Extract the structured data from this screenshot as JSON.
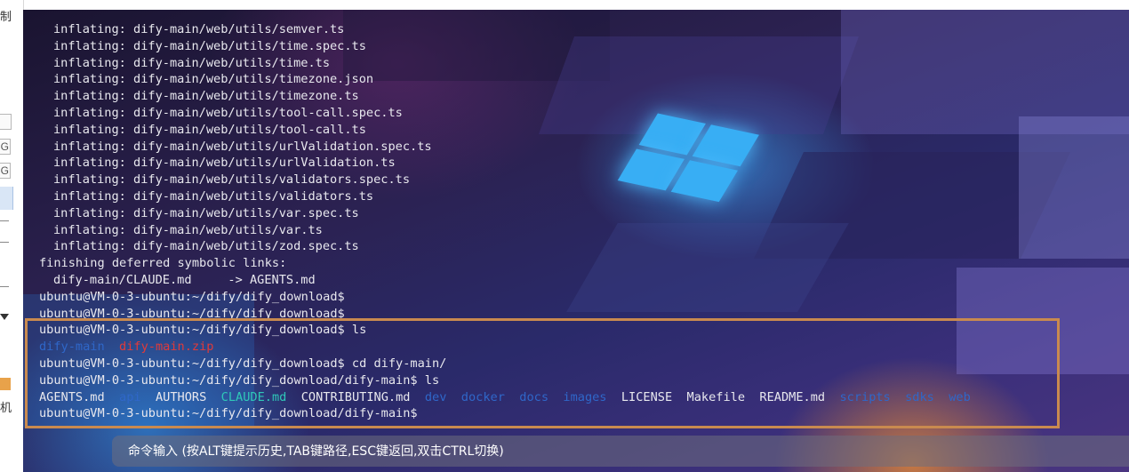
{
  "sidebar": {
    "top_char": "制",
    "box_letters": [
      "G",
      "G"
    ],
    "bottom_char": "机"
  },
  "terminal": {
    "lines": [
      {
        "indent": 1,
        "segments": [
          {
            "text": "inflating: dify-main/web/utils/semver.ts",
            "kind": "normal"
          }
        ]
      },
      {
        "indent": 1,
        "segments": [
          {
            "text": "inflating: dify-main/web/utils/time.spec.ts",
            "kind": "normal"
          }
        ]
      },
      {
        "indent": 1,
        "segments": [
          {
            "text": "inflating: dify-main/web/utils/time.ts",
            "kind": "normal"
          }
        ]
      },
      {
        "indent": 1,
        "segments": [
          {
            "text": "inflating: dify-main/web/utils/timezone.json",
            "kind": "normal"
          }
        ]
      },
      {
        "indent": 1,
        "segments": [
          {
            "text": "inflating: dify-main/web/utils/timezone.ts",
            "kind": "normal"
          }
        ]
      },
      {
        "indent": 1,
        "segments": [
          {
            "text": "inflating: dify-main/web/utils/tool-call.spec.ts",
            "kind": "normal"
          }
        ]
      },
      {
        "indent": 1,
        "segments": [
          {
            "text": "inflating: dify-main/web/utils/tool-call.ts",
            "kind": "normal"
          }
        ]
      },
      {
        "indent": 1,
        "segments": [
          {
            "text": "inflating: dify-main/web/utils/urlValidation.spec.ts",
            "kind": "normal"
          }
        ]
      },
      {
        "indent": 1,
        "segments": [
          {
            "text": "inflating: dify-main/web/utils/urlValidation.ts",
            "kind": "normal"
          }
        ]
      },
      {
        "indent": 1,
        "segments": [
          {
            "text": "inflating: dify-main/web/utils/validators.spec.ts",
            "kind": "normal"
          }
        ]
      },
      {
        "indent": 1,
        "segments": [
          {
            "text": "inflating: dify-main/web/utils/validators.ts",
            "kind": "normal"
          }
        ]
      },
      {
        "indent": 1,
        "segments": [
          {
            "text": "inflating: dify-main/web/utils/var.spec.ts",
            "kind": "normal"
          }
        ]
      },
      {
        "indent": 1,
        "segments": [
          {
            "text": "inflating: dify-main/web/utils/var.ts",
            "kind": "normal"
          }
        ]
      },
      {
        "indent": 1,
        "segments": [
          {
            "text": "inflating: dify-main/web/utils/zod.spec.ts",
            "kind": "normal"
          }
        ]
      },
      {
        "indent": 0,
        "segments": [
          {
            "text": "finishing deferred symbolic links:",
            "kind": "normal"
          }
        ]
      },
      {
        "indent": 1,
        "segments": [
          {
            "text": "dify-main/CLAUDE.md     -> AGENTS.md",
            "kind": "normal"
          }
        ]
      },
      {
        "indent": 0,
        "segments": [
          {
            "text": "ubuntu@VM-0-3-ubuntu:~/dify/dify_download$",
            "kind": "normal"
          }
        ]
      },
      {
        "indent": 0,
        "segments": [
          {
            "text": "ubuntu@VM-0-3-ubuntu:~/dify/dify_download$",
            "kind": "normal"
          }
        ]
      },
      {
        "indent": 0,
        "segments": [
          {
            "text": "ubuntu@VM-0-3-ubuntu:~/dify/dify_download$ ls",
            "kind": "normal"
          }
        ]
      },
      {
        "indent": 0,
        "segments": [
          {
            "text": "dify-main",
            "kind": "dir"
          },
          {
            "text": "  ",
            "kind": "normal"
          },
          {
            "text": "dify-main.zip",
            "kind": "zip"
          }
        ]
      },
      {
        "indent": 0,
        "segments": [
          {
            "text": "ubuntu@VM-0-3-ubuntu:~/dify/dify_download$ cd dify-main/",
            "kind": "normal"
          }
        ]
      },
      {
        "indent": 0,
        "segments": [
          {
            "text": "ubuntu@VM-0-3-ubuntu:~/dify/dify_download/dify-main$ ls",
            "kind": "normal"
          }
        ]
      },
      {
        "indent": 0,
        "segments": [
          {
            "text": "AGENTS.md",
            "kind": "normal"
          },
          {
            "text": "  ",
            "kind": "normal"
          },
          {
            "text": "api",
            "kind": "dir"
          },
          {
            "text": "  ",
            "kind": "normal"
          },
          {
            "text": "AUTHORS",
            "kind": "normal"
          },
          {
            "text": "  ",
            "kind": "normal"
          },
          {
            "text": "CLAUDE.md",
            "kind": "md"
          },
          {
            "text": "  ",
            "kind": "normal"
          },
          {
            "text": "CONTRIBUTING.md",
            "kind": "normal"
          },
          {
            "text": "  ",
            "kind": "normal"
          },
          {
            "text": "dev",
            "kind": "dir"
          },
          {
            "text": "  ",
            "kind": "normal"
          },
          {
            "text": "docker",
            "kind": "dir"
          },
          {
            "text": "  ",
            "kind": "normal"
          },
          {
            "text": "docs",
            "kind": "dir"
          },
          {
            "text": "  ",
            "kind": "normal"
          },
          {
            "text": "images",
            "kind": "dir"
          },
          {
            "text": "  ",
            "kind": "normal"
          },
          {
            "text": "LICENSE",
            "kind": "normal"
          },
          {
            "text": "  ",
            "kind": "normal"
          },
          {
            "text": "Makefile",
            "kind": "normal"
          },
          {
            "text": "  ",
            "kind": "normal"
          },
          {
            "text": "README.md",
            "kind": "normal"
          },
          {
            "text": "  ",
            "kind": "normal"
          },
          {
            "text": "scripts",
            "kind": "dir"
          },
          {
            "text": "  ",
            "kind": "normal"
          },
          {
            "text": "sdks",
            "kind": "dir"
          },
          {
            "text": "  ",
            "kind": "normal"
          },
          {
            "text": "web",
            "kind": "dir"
          }
        ]
      },
      {
        "indent": 0,
        "segments": [
          {
            "text": "ubuntu@VM-0-3-ubuntu:~/dify/dify_download/dify-main$",
            "kind": "normal"
          }
        ]
      }
    ]
  },
  "command_input": {
    "placeholder": "命令输入 (按ALT键提示历史,TAB键路径,ESC键返回,双击CTRL切换)"
  },
  "colors": {
    "dir": "#2f67c9",
    "zip": "#e03a3a",
    "md_link": "#2fc8b8",
    "highlight_border": "#c98a4f",
    "text": "#e8e8ee"
  }
}
